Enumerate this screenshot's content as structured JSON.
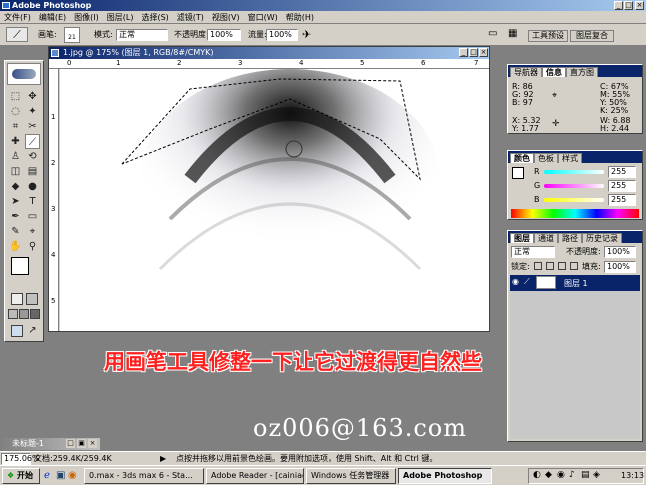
{
  "app": {
    "title": "Adobe Photoshop"
  },
  "menu": [
    "文件(F)",
    "编辑(E)",
    "图像(I)",
    "图层(L)",
    "选择(S)",
    "滤镜(T)",
    "视图(V)",
    "窗口(W)",
    "帮助(H)"
  ],
  "options": {
    "brush_label": "画笔:",
    "brush_size": "21",
    "mode_label": "模式:",
    "mode_value": "正常",
    "opacity_label": "不透明度:",
    "opacity_value": "100%",
    "flow_label": "流量:",
    "flow_value": "100%"
  },
  "palette_well": {
    "tab1": "工具预设",
    "tab2": "图层复合"
  },
  "document": {
    "title": "1.jpg @ 175% (图层 1, RGB/8#/CMYK)",
    "ruler_top": [
      "0",
      "1",
      "2",
      "3",
      "4",
      "5",
      "6",
      "7"
    ],
    "ruler_left": [
      "1",
      "2",
      "3",
      "4",
      "5"
    ]
  },
  "info_panel": {
    "tabs": [
      "导航器",
      "信息",
      "直方图"
    ],
    "R": "86",
    "G": "92",
    "B": "97",
    "C": "67%",
    "M": "55%",
    "Y": "50%",
    "K": "25%",
    "X": "5.32",
    "Y2": "1.77",
    "W": "6.88",
    "H": "2.44"
  },
  "color_panel": {
    "tabs": [
      "颜色",
      "色板",
      "样式"
    ],
    "R": "255",
    "G": "255",
    "B": "255"
  },
  "layers_panel": {
    "tabs": [
      "图层",
      "通道",
      "路径",
      "历史记录"
    ],
    "blend_mode": "正常",
    "opacity_label": "不透明度:",
    "opacity_value": "100%",
    "lock_label": "锁定:",
    "fill_label": "填充:",
    "fill_value": "100%",
    "layer_name": "图层 1"
  },
  "caption": "用画笔工具修整一下让它过渡得更自然些",
  "email": "oz006@163.com",
  "minimized_doc": "未标题-1",
  "status": {
    "zoom": "175.06%",
    "doc": "文档:259.4K/259.4K",
    "hint": "点按并拖移以用前景色绘画。要用附加选项，使用 Shift、Alt 和 Ctrl 键。"
  },
  "taskbar": {
    "start": "开始",
    "items": [
      "0.max - 3ds max 6 - Sta...",
      "Adobe Reader - [cainiaot...",
      "Windows 任务管理器",
      "Adobe Photoshop"
    ],
    "time": "13:13"
  },
  "colors": {
    "accent": "#0a246a",
    "caption": "#ff2020"
  }
}
